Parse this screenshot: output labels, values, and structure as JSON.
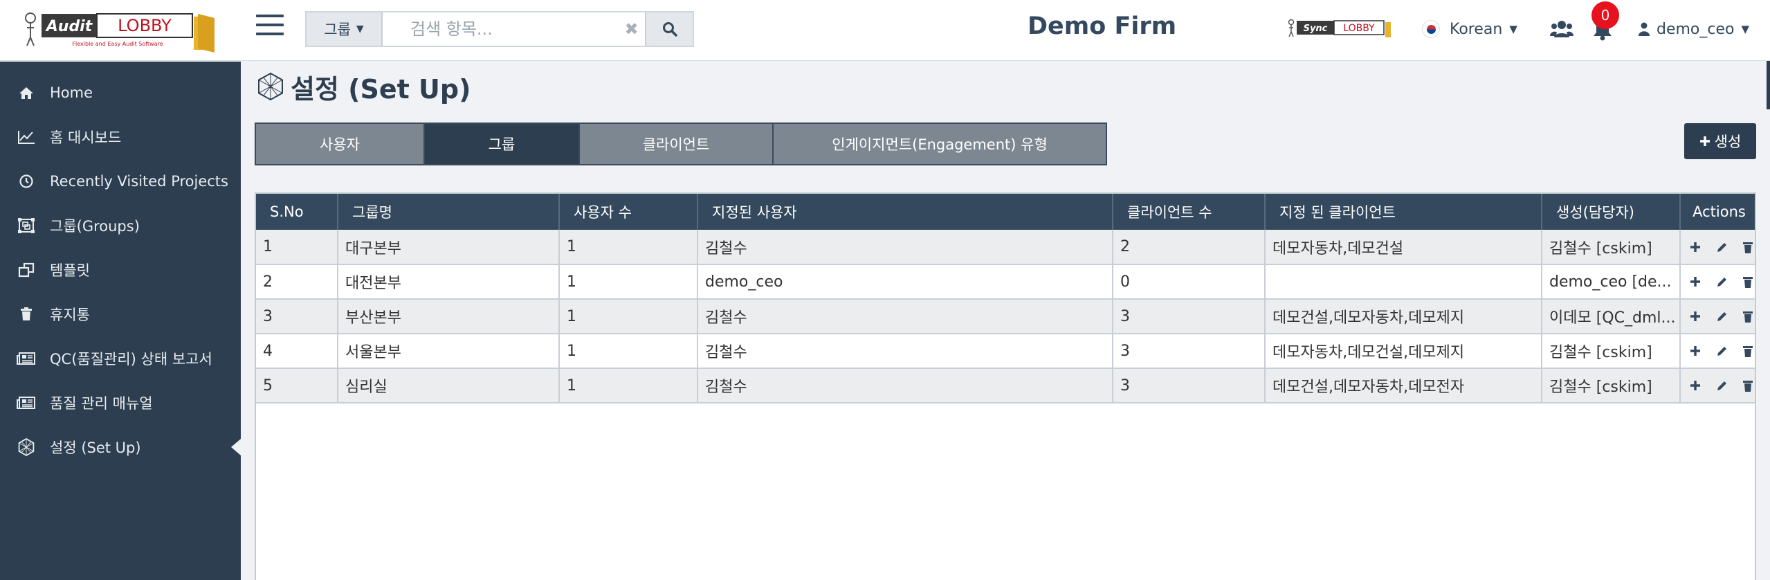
{
  "header": {
    "logo_text": "Audit LOBBY",
    "logo_tagline": "Flexible and Easy Audit Software",
    "search": {
      "category": "그룹",
      "placeholder": "검색 항목..."
    },
    "firm_title": "Demo Firm",
    "sync_logo_text": "Sync LOBBY",
    "language": "Korean",
    "notification_count": "0",
    "user": "demo_ceo"
  },
  "sidebar": {
    "items": [
      {
        "label": "Home",
        "icon": "home-icon"
      },
      {
        "label": "홈 대시보드",
        "icon": "chart-line-icon"
      },
      {
        "label": "Recently Visited Projects",
        "icon": "clock-icon"
      },
      {
        "label": "그룹(Groups)",
        "icon": "object-group-icon"
      },
      {
        "label": "템플릿",
        "icon": "clone-icon"
      },
      {
        "label": "휴지통",
        "icon": "trash-icon"
      },
      {
        "label": "QC(품질관리) 상태 보고서",
        "icon": "newspaper-icon"
      },
      {
        "label": "품질 관리 매뉴얼",
        "icon": "newspaper-icon"
      },
      {
        "label": "설정 (Set Up)",
        "icon": "setup-icon",
        "active": true
      }
    ]
  },
  "page": {
    "title": "설정 (Set Up)",
    "tabs": [
      {
        "label": "사용자"
      },
      {
        "label": "그룹",
        "active": true
      },
      {
        "label": "클라이언트"
      },
      {
        "label": "인게이지먼트(Engagement) 유형"
      }
    ],
    "create_label": "생성"
  },
  "table": {
    "columns": [
      "S.No",
      "그룹명",
      "사용자 수",
      "지정된 사용자",
      "클라이언트 수",
      "지정 된 클라이언트",
      "생성(담당자)",
      "Actions"
    ],
    "rows": [
      {
        "sno": "1",
        "name": "대구본부",
        "user_count": "1",
        "users": "김철수",
        "client_count": "2",
        "clients": "데모자동차,데모건설",
        "created_by": "김철수 [cskim]"
      },
      {
        "sno": "2",
        "name": "대전본부",
        "user_count": "1",
        "users": "demo_ceo",
        "client_count": "0",
        "clients": "",
        "created_by": "demo_ceo [de..."
      },
      {
        "sno": "3",
        "name": "부산본부",
        "user_count": "1",
        "users": "김철수",
        "client_count": "3",
        "clients": "데모건설,데모자동차,데모제지",
        "created_by": "이데모 [QC_dml..."
      },
      {
        "sno": "4",
        "name": "서울본부",
        "user_count": "1",
        "users": "김철수",
        "client_count": "3",
        "clients": "데모자동차,데모건설,데모제지",
        "created_by": "김철수 [cskim]"
      },
      {
        "sno": "5",
        "name": "심리실",
        "user_count": "1",
        "users": "김철수",
        "client_count": "3",
        "clients": "데모건설,데모자동차,데모전자",
        "created_by": "김철수 [cskim]"
      }
    ]
  },
  "colors": {
    "sidebar_bg": "#2c3e50",
    "header_dark": "#34495e",
    "tab_inactive": "#7d8791",
    "badge_red": "#e8111e"
  }
}
